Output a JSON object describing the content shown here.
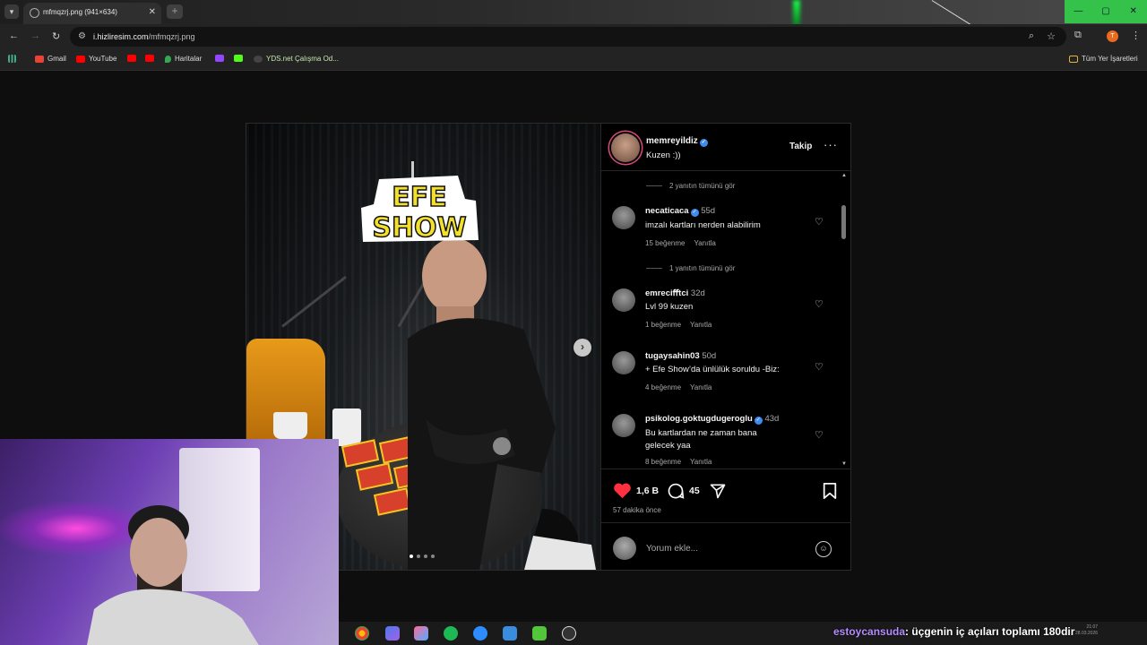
{
  "browser": {
    "tab_title": "mfmqzrj.png (941×634)",
    "url_domain": "i.hizliresim.com",
    "url_path": "/mfmqzrj.png",
    "profile_initial": "T",
    "bookmarks": [
      {
        "label": "Gmail",
        "icon": "gmail-icon",
        "color": "#ea4335"
      },
      {
        "label": "YouTube",
        "icon": "youtube-icon",
        "color": "#ff0000"
      },
      {
        "label": "",
        "icon": "youtube-icon",
        "color": "#ff0000"
      },
      {
        "label": "",
        "icon": "youtube-icon",
        "color": "#ff0000"
      },
      {
        "label": "Haritalar",
        "icon": "maps-pin-icon",
        "color": "#34a853"
      },
      {
        "label": "",
        "icon": "twitch-icon",
        "color": "#9146ff"
      },
      {
        "label": "",
        "icon": "kick-icon",
        "color": "#53fc18"
      },
      {
        "label": "YDS.net Çalışma Od...",
        "icon": "yds-icon",
        "color": "#444444"
      }
    ],
    "all_bookmarks_label": "Tüm Yer İşaretleri"
  },
  "post": {
    "author": "memreyildiz",
    "caption": "Kuzen :))",
    "follow_label": "Takip",
    "more_label": "···",
    "logo_line1": "EFE",
    "logo_line2": "SHOW",
    "comments": [
      {
        "type": "seeall",
        "text": "2 yanıtın tümünü gör"
      },
      {
        "type": "comment",
        "user": "necaticaca",
        "verified": true,
        "time": "55d",
        "text": "imzalı kartları nerden alabilirim",
        "likes": "15 beğenme",
        "reply": "Yanıtla"
      },
      {
        "type": "seeall",
        "text": "1 yanıtın tümünü gör"
      },
      {
        "type": "comment",
        "user": "emreciﬀtci",
        "verified": false,
        "time": "32d",
        "text": "Lvl 99 kuzen",
        "likes": "1 beğenme",
        "reply": "Yanıtla"
      },
      {
        "type": "comment",
        "user": "tugaysahin03",
        "verified": false,
        "time": "50d",
        "text": "+ Efe Show’da ünlülük soruldu -Biz:",
        "likes": "4 beğenme",
        "reply": "Yanıtla"
      },
      {
        "type": "comment",
        "user": "psikolog.goktugdugeroglu",
        "verified": true,
        "time": "43d",
        "text": "Bu kartlardan ne zaman bana gelecek yaa",
        "likes": "8 beğenme",
        "reply": "Yanıtla"
      }
    ],
    "like_count": "1,6 B",
    "comment_count": "45",
    "posted_ago": "57 dakika önce",
    "add_comment_placeholder": "Yorum ekle...",
    "carousel_total": 4,
    "carousel_current": 1
  },
  "overlay": {
    "ticker_user": "estoycansuda",
    "ticker_text": ": üçgenin iç açıları toplamı 180dir",
    "clock_time": "21:07",
    "clock_date": "28.03.2026"
  },
  "colors": {
    "like_red": "#ff3040",
    "verified_blue": "#3f8cf0",
    "window_controls": "#34c24a"
  }
}
